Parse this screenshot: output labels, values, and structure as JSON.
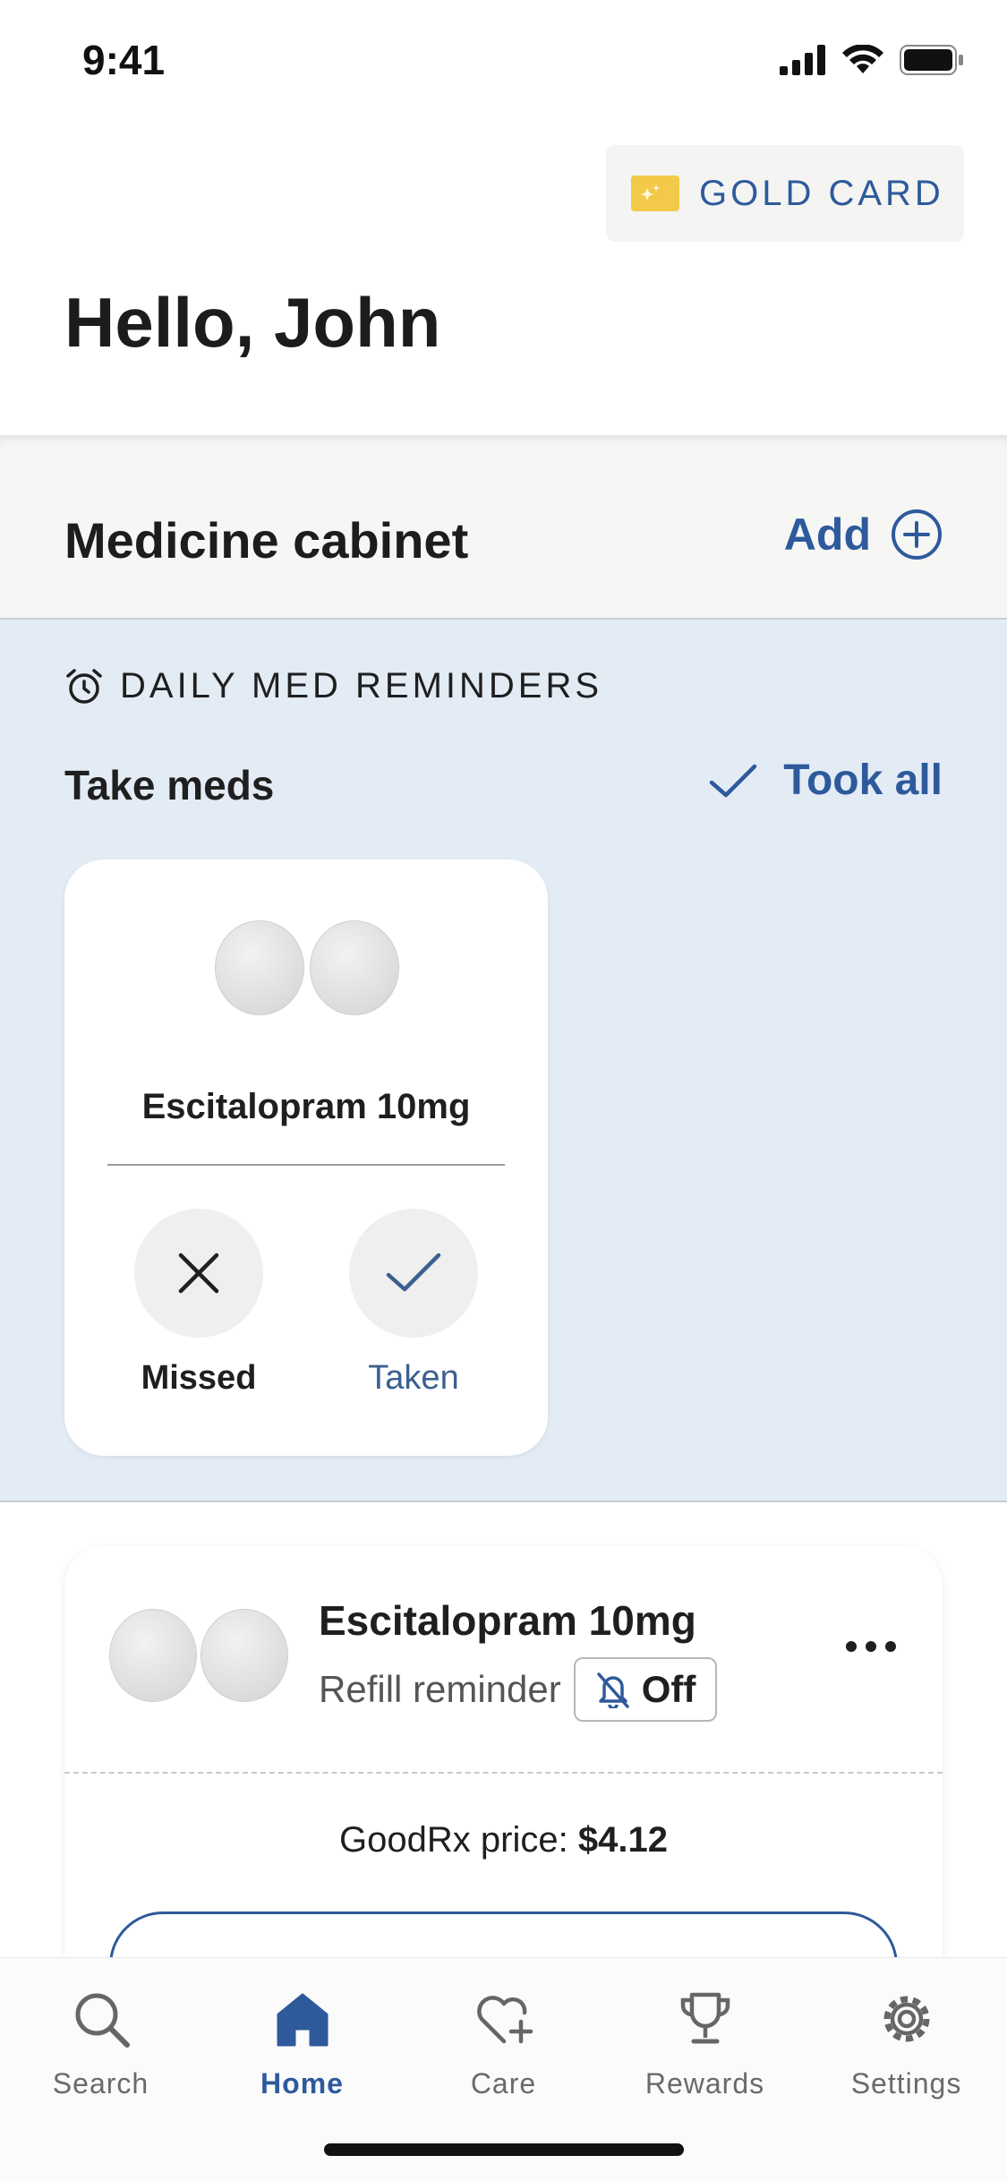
{
  "status_bar": {
    "time": "9:41"
  },
  "header": {
    "gold_card_label": "GOLD CARD",
    "greeting": "Hello, John"
  },
  "cabinet": {
    "title": "Medicine cabinet",
    "add_label": "Add"
  },
  "reminders": {
    "eyebrow": "DAILY MED REMINDERS",
    "subtitle": "Take meds",
    "took_all_label": "Took all",
    "card": {
      "medication": "Escitalopram 10mg",
      "missed_label": "Missed",
      "taken_label": "Taken"
    }
  },
  "rx_card": {
    "medication": "Escitalopram 10mg",
    "refill_label": "Refill reminder",
    "refill_status": "Off",
    "price_label": "GoodRx price:",
    "price_value": "$4.12"
  },
  "tabs": [
    {
      "label": "Search",
      "icon": "search-icon",
      "active": false
    },
    {
      "label": "Home",
      "icon": "home-icon",
      "active": true
    },
    {
      "label": "Care",
      "icon": "heart-plus-icon",
      "active": false
    },
    {
      "label": "Rewards",
      "icon": "trophy-icon",
      "active": false
    },
    {
      "label": "Settings",
      "icon": "gear-icon",
      "active": false
    }
  ],
  "colors": {
    "accent": "#2e5a9c",
    "gold": "#f3c94a",
    "reminder_bg": "#e3ebf5"
  }
}
